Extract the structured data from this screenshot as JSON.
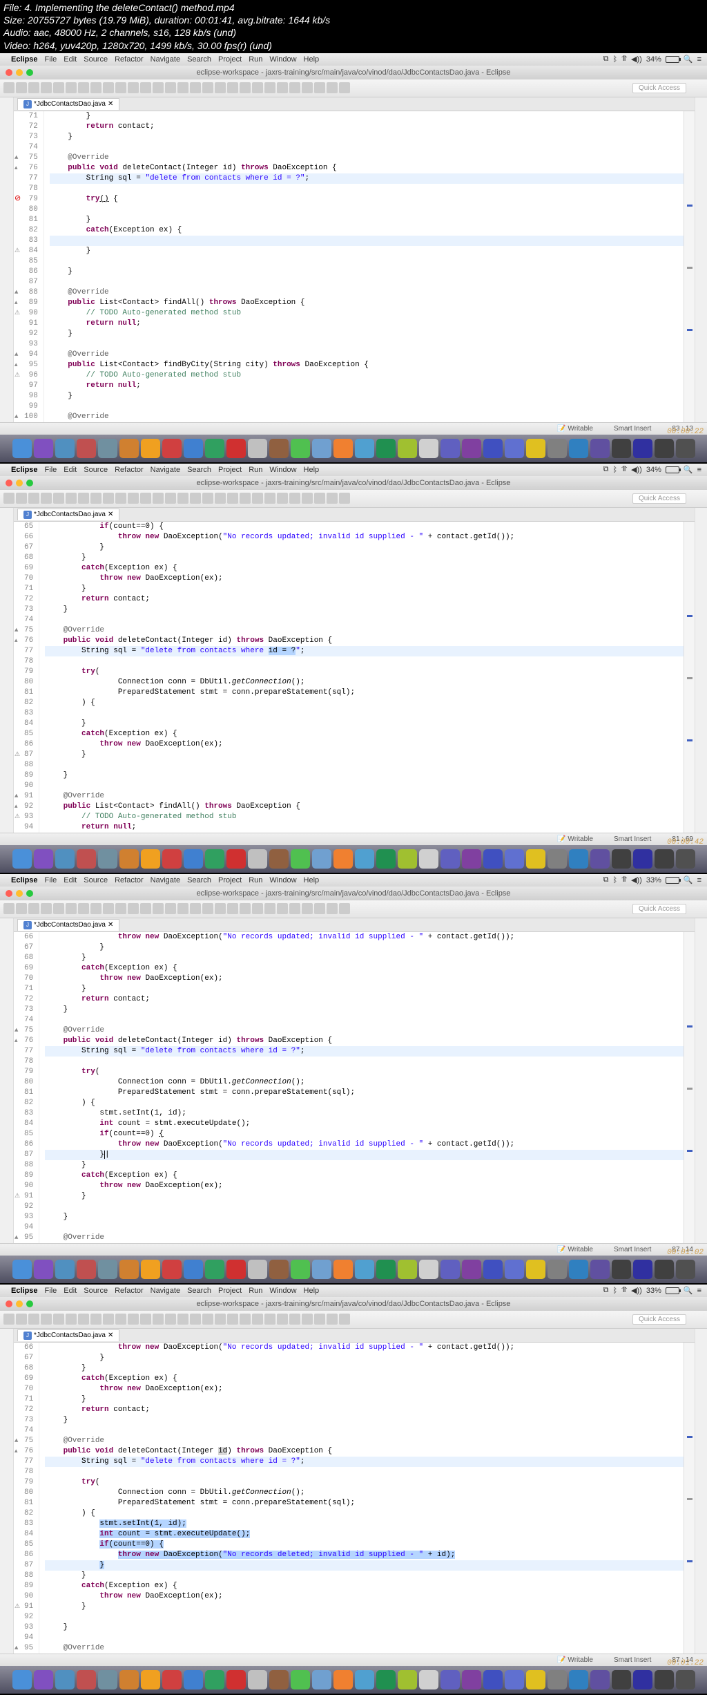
{
  "meta": {
    "file": "File: 4. Implementing the deleteContact() method.mp4",
    "size": "Size: 20755727 bytes (19.79 MiB), duration: 00:01:41, avg.bitrate: 1644 kb/s",
    "audio": "Audio: aac, 48000 Hz, 2 channels, s16, 128 kb/s (und)",
    "video": "Video: h264, yuv420p, 1280x720, 1499 kb/s, 30.00 fps(r) (und)"
  },
  "menubar": {
    "app": "Eclipse",
    "items": [
      "File",
      "Edit",
      "Source",
      "Refactor",
      "Navigate",
      "Search",
      "Project",
      "Run",
      "Window",
      "Help"
    ]
  },
  "window_title": "eclipse-workspace - jaxrs-training/src/main/java/co/vinod/dao/JdbcContactsDao.java - Eclipse",
  "quick_access": "Quick Access",
  "tab_name": "JdbcContactsDao.java",
  "frames": [
    {
      "battery": "34%",
      "timestamp": "00:00:22",
      "status": {
        "writable": "Writable",
        "insert": "Smart Insert",
        "pos": "83 : 13"
      },
      "lines": [
        {
          "n": "71",
          "t": "        }"
        },
        {
          "n": "72",
          "t": "        <kw>return</kw> contact;"
        },
        {
          "n": "73",
          "t": "    }"
        },
        {
          "n": "74",
          "t": ""
        },
        {
          "n": "75",
          "t": "    <ann>@Override</ann>",
          "m": "o"
        },
        {
          "n": "76",
          "t": "    <kw>public void</kw> deleteContact(Integer id) <kw>throws</kw> DaoException {",
          "m": "a"
        },
        {
          "n": "77",
          "t": "        String sql = <str>\"delete from contacts where id = ?\"</str>;",
          "hl": true
        },
        {
          "n": "78",
          "t": ""
        },
        {
          "n": "79",
          "t": "        <kw>try</kw><u>()</u> {",
          "m": "e"
        },
        {
          "n": "80",
          "t": "            "
        },
        {
          "n": "81",
          "t": "        }"
        },
        {
          "n": "82",
          "t": "        <kw>catch</kw>(Exception ex) {"
        },
        {
          "n": "83",
          "t": "            ",
          "hl": true
        },
        {
          "n": "84",
          "t": "        }",
          "m": "w"
        },
        {
          "n": "85",
          "t": ""
        },
        {
          "n": "86",
          "t": "    }"
        },
        {
          "n": "87",
          "t": ""
        },
        {
          "n": "88",
          "t": "    <ann>@Override</ann>",
          "m": "o"
        },
        {
          "n": "89",
          "t": "    <kw>public</kw> List&lt;Contact&gt; findAll() <kw>throws</kw> DaoException {",
          "m": "a"
        },
        {
          "n": "90",
          "t": "        <cmt>// TODO Auto-generated method stub</cmt>",
          "m": "w"
        },
        {
          "n": "91",
          "t": "        <kw>return null</kw>;"
        },
        {
          "n": "92",
          "t": "    }"
        },
        {
          "n": "93",
          "t": ""
        },
        {
          "n": "94",
          "t": "    <ann>@Override</ann>",
          "m": "o"
        },
        {
          "n": "95",
          "t": "    <kw>public</kw> List&lt;Contact&gt; findByCity(String city) <kw>throws</kw> DaoException {",
          "m": "a"
        },
        {
          "n": "96",
          "t": "        <cmt>// TODO Auto-generated method stub</cmt>",
          "m": "w"
        },
        {
          "n": "97",
          "t": "        <kw>return null</kw>;"
        },
        {
          "n": "98",
          "t": "    }"
        },
        {
          "n": "99",
          "t": ""
        },
        {
          "n": "100",
          "t": "    <ann>@Override</ann>",
          "m": "o"
        }
      ]
    },
    {
      "battery": "34%",
      "timestamp": "00:00:42",
      "status": {
        "writable": "Writable",
        "insert": "Smart Insert",
        "pos": "81 : 69"
      },
      "lines": [
        {
          "n": "65",
          "t": "            <kw>if</kw>(count==0) {"
        },
        {
          "n": "66",
          "t": "                <kw>throw new</kw> DaoException(<str>\"No records updated; invalid id supplied - \"</str> + contact.getId());"
        },
        {
          "n": "67",
          "t": "            }"
        },
        {
          "n": "68",
          "t": "        }"
        },
        {
          "n": "69",
          "t": "        <kw>catch</kw>(Exception ex) {"
        },
        {
          "n": "70",
          "t": "            <kw>throw new</kw> DaoException(ex);"
        },
        {
          "n": "71",
          "t": "        }"
        },
        {
          "n": "72",
          "t": "        <kw>return</kw> contact;"
        },
        {
          "n": "73",
          "t": "    }"
        },
        {
          "n": "74",
          "t": ""
        },
        {
          "n": "75",
          "t": "    <ann>@Override</ann>",
          "m": "o"
        },
        {
          "n": "76",
          "t": "    <kw>public void</kw> deleteContact(Integer id) <kw>throws</kw> DaoException {",
          "m": "a"
        },
        {
          "n": "77",
          "t": "        String sql = <str>\"delete from contacts where </str><span class='highlight-sel'>id = ?</span><str>\"</str>;",
          "hl": true
        },
        {
          "n": "78",
          "t": ""
        },
        {
          "n": "79",
          "t": "        <kw>try</kw>("
        },
        {
          "n": "80",
          "t": "                Connection conn = DbUtil.<i>getConnection</i>();"
        },
        {
          "n": "81",
          "t": "                PreparedStatement stmt = conn.prepareStatement(sql);"
        },
        {
          "n": "82",
          "t": "        ) {"
        },
        {
          "n": "83",
          "t": "            "
        },
        {
          "n": "84",
          "t": "        }"
        },
        {
          "n": "85",
          "t": "        <kw>catch</kw>(Exception ex) {"
        },
        {
          "n": "86",
          "t": "            <kw>throw new</kw> DaoException(ex);"
        },
        {
          "n": "87",
          "t": "        }",
          "m": "w"
        },
        {
          "n": "88",
          "t": ""
        },
        {
          "n": "89",
          "t": "    }"
        },
        {
          "n": "90",
          "t": ""
        },
        {
          "n": "91",
          "t": "    <ann>@Override</ann>",
          "m": "o"
        },
        {
          "n": "92",
          "t": "    <kw>public</kw> List&lt;Contact&gt; findAll() <kw>throws</kw> DaoException {",
          "m": "a"
        },
        {
          "n": "93",
          "t": "        <cmt>// TODO Auto-generated method stub</cmt>",
          "m": "w"
        },
        {
          "n": "94",
          "t": "        <kw>return null</kw>;"
        }
      ]
    },
    {
      "battery": "33%",
      "timestamp": "00:01:02",
      "status": {
        "writable": "Writable",
        "insert": "Smart Insert",
        "pos": "87 : 14"
      },
      "lines": [
        {
          "n": "66",
          "t": "                <kw>throw new</kw> DaoException(<str>\"No records updated; invalid id supplied - \"</str> + contact.getId());"
        },
        {
          "n": "67",
          "t": "            }"
        },
        {
          "n": "68",
          "t": "        }"
        },
        {
          "n": "69",
          "t": "        <kw>catch</kw>(Exception ex) {"
        },
        {
          "n": "70",
          "t": "            <kw>throw new</kw> DaoException(ex);"
        },
        {
          "n": "71",
          "t": "        }"
        },
        {
          "n": "72",
          "t": "        <kw>return</kw> contact;"
        },
        {
          "n": "73",
          "t": "    }"
        },
        {
          "n": "74",
          "t": ""
        },
        {
          "n": "75",
          "t": "    <ann>@Override</ann>",
          "m": "o"
        },
        {
          "n": "76",
          "t": "    <kw>public void</kw> deleteContact(Integer id) <kw>throws</kw> DaoException {",
          "m": "a"
        },
        {
          "n": "77",
          "t": "        String sql = <str>\"delete from contacts where id = ?\"</str>;",
          "hl": true
        },
        {
          "n": "78",
          "t": ""
        },
        {
          "n": "79",
          "t": "        <kw>try</kw>("
        },
        {
          "n": "80",
          "t": "                Connection conn = DbUtil.<i>getConnection</i>();"
        },
        {
          "n": "81",
          "t": "                PreparedStatement stmt = conn.prepareStatement(sql);"
        },
        {
          "n": "82",
          "t": "        ) {"
        },
        {
          "n": "83",
          "t": "            stmt.setInt(1, id);"
        },
        {
          "n": "84",
          "t": "            <kw>int</kw> count = stmt.executeUpdate();"
        },
        {
          "n": "85",
          "t": "            <kw>if</kw>(count==0) <u>{</u>"
        },
        {
          "n": "86",
          "t": "                <kw>throw new</kw> DaoException(<str>\"No records updated; invalid id supplied - \"</str> + contact.getId());"
        },
        {
          "n": "87",
          "t": "            }<span style='border-left:1px solid #000'>|</span>",
          "hl": true
        },
        {
          "n": "88",
          "t": "        }"
        },
        {
          "n": "89",
          "t": "        <kw>catch</kw>(Exception ex) {"
        },
        {
          "n": "90",
          "t": "            <kw>throw new</kw> DaoException(ex);"
        },
        {
          "n": "91",
          "t": "        }",
          "m": "w"
        },
        {
          "n": "92",
          "t": ""
        },
        {
          "n": "93",
          "t": "    }"
        },
        {
          "n": "94",
          "t": ""
        },
        {
          "n": "95",
          "t": "    <ann>@Override</ann>",
          "m": "o"
        }
      ]
    },
    {
      "battery": "33%",
      "timestamp": "00:01:22",
      "status": {
        "writable": "Writable",
        "insert": "Smart Insert",
        "pos": "87 : 14"
      },
      "lines": [
        {
          "n": "66",
          "t": "                <kw>throw new</kw> DaoException(<str>\"No records updated; invalid id supplied - \"</str> + contact.getId());"
        },
        {
          "n": "67",
          "t": "            }"
        },
        {
          "n": "68",
          "t": "        }"
        },
        {
          "n": "69",
          "t": "        <kw>catch</kw>(Exception ex) {"
        },
        {
          "n": "70",
          "t": "            <kw>throw new</kw> DaoException(ex);"
        },
        {
          "n": "71",
          "t": "        }"
        },
        {
          "n": "72",
          "t": "        <kw>return</kw> contact;"
        },
        {
          "n": "73",
          "t": "    }"
        },
        {
          "n": "74",
          "t": ""
        },
        {
          "n": "75",
          "t": "    <ann>@Override</ann>",
          "m": "o"
        },
        {
          "n": "76",
          "t": "    <kw>public void</kw> deleteContact(Integer <span style='background:#d8d8d8'>id</span>) <kw>throws</kw> DaoException {",
          "m": "a"
        },
        {
          "n": "77",
          "t": "        String sql = <str>\"delete from contacts where id = ?\"</str>;",
          "hl": true
        },
        {
          "n": "78",
          "t": ""
        },
        {
          "n": "79",
          "t": "        <kw>try</kw>("
        },
        {
          "n": "80",
          "t": "                Connection conn = DbUtil.<i>getConnection</i>();"
        },
        {
          "n": "81",
          "t": "                PreparedStatement stmt = conn.prepareStatement(sql);"
        },
        {
          "n": "82",
          "t": "        ) {"
        },
        {
          "n": "83",
          "t": "            <span class='highlight-sel'>stmt.setInt(1, id);</span>"
        },
        {
          "n": "84",
          "t": "            <span class='highlight-sel'><kw>int</kw> count = stmt.executeUpdate();</span>"
        },
        {
          "n": "85",
          "t": "            <span class='highlight-sel'><kw>if</kw>(count==0) {</span>"
        },
        {
          "n": "86",
          "t": "                <span class='highlight-sel'><kw>throw new</kw> DaoException(<str>\"No records deleted; invalid id supplied - \"</str> + id);</span>"
        },
        {
          "n": "87",
          "t": "            <span class='highlight-sel'>}</span>",
          "hl": true
        },
        {
          "n": "88",
          "t": "        }"
        },
        {
          "n": "89",
          "t": "        <kw>catch</kw>(Exception ex) {"
        },
        {
          "n": "90",
          "t": "            <kw>throw new</kw> DaoException(ex);"
        },
        {
          "n": "91",
          "t": "        }",
          "m": "w"
        },
        {
          "n": "92",
          "t": ""
        },
        {
          "n": "93",
          "t": "    }"
        },
        {
          "n": "94",
          "t": ""
        },
        {
          "n": "95",
          "t": "    <ann>@Override</ann>",
          "m": "o"
        }
      ]
    }
  ],
  "dock_colors": [
    "#4a90d9",
    "#8050c0",
    "#5090c0",
    "#c05050",
    "#7090a0",
    "#d08030",
    "#f0a020",
    "#d04040",
    "#4080d0",
    "#30a060",
    "#d03030",
    "#c0c0c0",
    "#906040",
    "#50c050",
    "#70a0d0",
    "#f08030",
    "#50a0d0",
    "#209050",
    "#a0c030",
    "#d0d0d0",
    "#6060c0",
    "#8040a0",
    "#4050c0",
    "#6070d0",
    "#e0c020",
    "#808080",
    "#3080c0",
    "#6050a0",
    "#404040",
    "#3030a0",
    "#404040",
    "#505050"
  ]
}
